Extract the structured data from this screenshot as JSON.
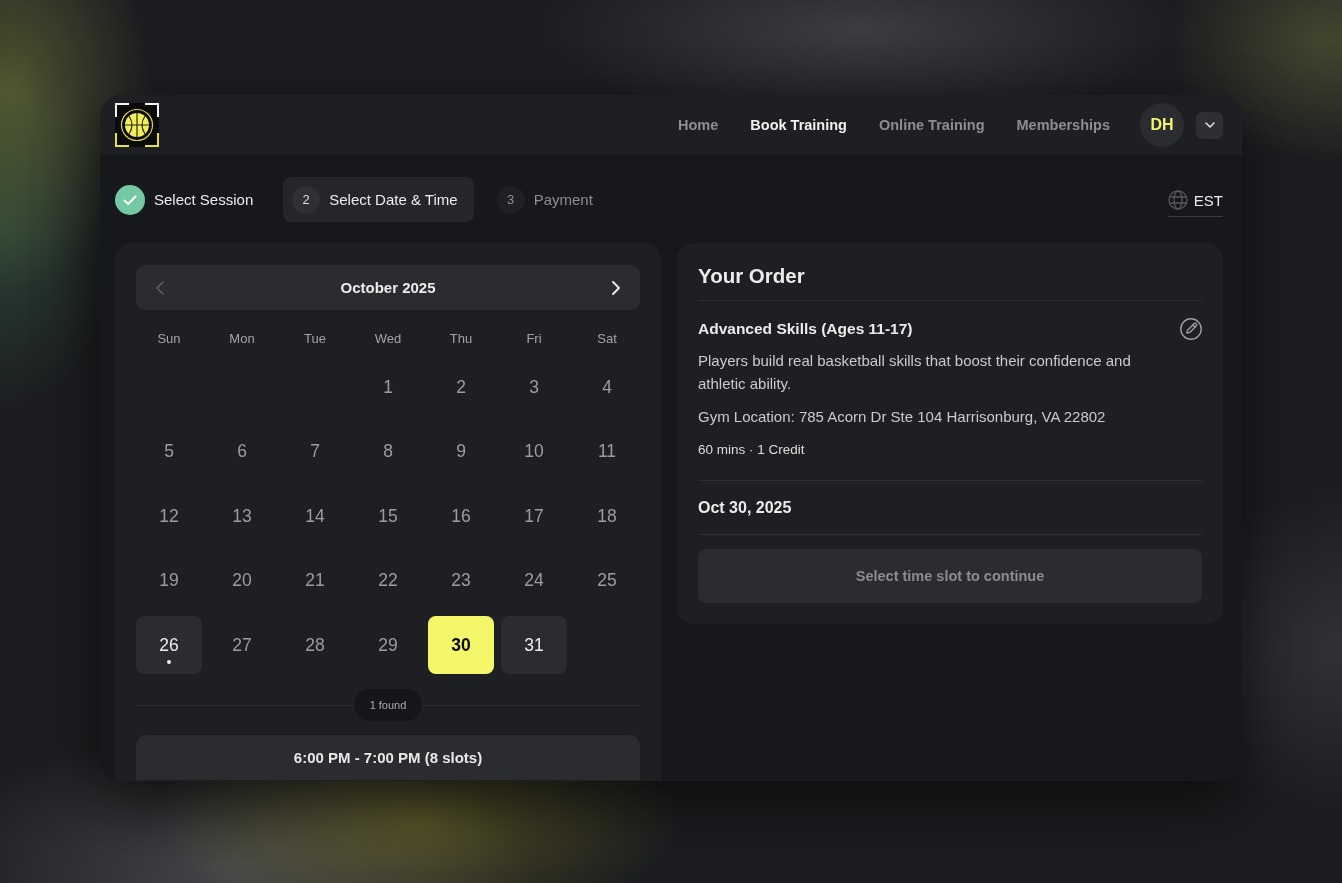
{
  "header": {
    "nav": [
      {
        "label": "Home",
        "selected": false
      },
      {
        "label": "Book Training",
        "selected": true
      },
      {
        "label": "Online Training",
        "selected": false
      },
      {
        "label": "Memberships",
        "selected": false
      }
    ],
    "avatar": {
      "initials": "DH"
    }
  },
  "stepper": {
    "steps": [
      {
        "label": "Select Session",
        "completed": true,
        "selected": false
      },
      {
        "number": "2",
        "label": "Select Date & Time",
        "completed": false,
        "selected": true
      },
      {
        "number": "3",
        "label": "Payment",
        "completed": false,
        "selected": false
      }
    ]
  },
  "timezone": {
    "label": "EST"
  },
  "calendar": {
    "month": "October 2025",
    "prev_button": {
      "disabled": true
    },
    "next_button": {
      "disabled": false
    },
    "weekdays": [
      "Sun",
      "Mon",
      "Tue",
      "Wed",
      "Thu",
      "Fri",
      "Sat"
    ],
    "weeks": [
      [
        {
          "kind": "blank"
        },
        {
          "kind": "blank"
        },
        {
          "kind": "blank"
        },
        {
          "kind": "day",
          "day": "1",
          "available": false,
          "selected": false,
          "marked": false
        },
        {
          "kind": "day",
          "day": "2",
          "available": false,
          "selected": false,
          "marked": false
        },
        {
          "kind": "day",
          "day": "3",
          "available": false,
          "selected": false,
          "marked": false
        },
        {
          "kind": "day",
          "day": "4",
          "available": false,
          "selected": false,
          "marked": false
        }
      ],
      [
        {
          "kind": "day",
          "day": "5",
          "available": false,
          "selected": false,
          "marked": false
        },
        {
          "kind": "day",
          "day": "6",
          "available": false,
          "selected": false,
          "marked": false
        },
        {
          "kind": "day",
          "day": "7",
          "available": false,
          "selected": false,
          "marked": false
        },
        {
          "kind": "day",
          "day": "8",
          "available": false,
          "selected": false,
          "marked": false
        },
        {
          "kind": "day",
          "day": "9",
          "available": false,
          "selected": false,
          "marked": false
        },
        {
          "kind": "day",
          "day": "10",
          "available": false,
          "selected": false,
          "marked": false
        },
        {
          "kind": "day",
          "day": "11",
          "available": false,
          "selected": false,
          "marked": false
        }
      ],
      [
        {
          "kind": "day",
          "day": "12",
          "available": false,
          "selected": false,
          "marked": false
        },
        {
          "kind": "day",
          "day": "13",
          "available": false,
          "selected": false,
          "marked": false
        },
        {
          "kind": "day",
          "day": "14",
          "available": false,
          "selected": false,
          "marked": false
        },
        {
          "kind": "day",
          "day": "15",
          "available": false,
          "selected": false,
          "marked": false
        },
        {
          "kind": "day",
          "day": "16",
          "available": false,
          "selected": false,
          "marked": false
        },
        {
          "kind": "day",
          "day": "17",
          "available": false,
          "selected": false,
          "marked": false
        },
        {
          "kind": "day",
          "day": "18",
          "available": false,
          "selected": false,
          "marked": false
        }
      ],
      [
        {
          "kind": "day",
          "day": "19",
          "available": false,
          "selected": false,
          "marked": false
        },
        {
          "kind": "day",
          "day": "20",
          "available": false,
          "selected": false,
          "marked": false
        },
        {
          "kind": "day",
          "day": "21",
          "available": false,
          "selected": false,
          "marked": false
        },
        {
          "kind": "day",
          "day": "22",
          "available": false,
          "selected": false,
          "marked": false
        },
        {
          "kind": "day",
          "day": "23",
          "available": false,
          "selected": false,
          "marked": false
        },
        {
          "kind": "day",
          "day": "24",
          "available": false,
          "selected": false,
          "marked": false
        },
        {
          "kind": "day",
          "day": "25",
          "available": false,
          "selected": false,
          "marked": false
        }
      ],
      [
        {
          "kind": "day",
          "day": "26",
          "available": true,
          "selected": false,
          "marked": true
        },
        {
          "kind": "day",
          "day": "27",
          "available": false,
          "selected": false,
          "marked": false
        },
        {
          "kind": "day",
          "day": "28",
          "available": false,
          "selected": false,
          "marked": false
        },
        {
          "kind": "day",
          "day": "29",
          "available": false,
          "selected": false,
          "marked": false
        },
        {
          "kind": "day",
          "day": "30",
          "available": true,
          "selected": true,
          "marked": false
        },
        {
          "kind": "day",
          "day": "31",
          "available": true,
          "selected": false,
          "marked": false
        },
        {
          "kind": "blank"
        }
      ]
    ],
    "results": {
      "count": "1 found"
    },
    "slots": [
      {
        "label": "6:00 PM - 7:00 PM (8 slots)",
        "selected": false
      }
    ]
  },
  "order": {
    "title": "Your Order",
    "session": {
      "name": "Advanced Skills (Ages 11-17)",
      "description": "Players build real basketball skills that boost their confidence and athletic ability.",
      "location": "Gym Location: 785 Acorn Dr Ste 104 Harrisonburg, VA 22802",
      "meta": "60 mins · 1 Credit"
    },
    "date": "Oct 30, 2025",
    "continue_button": {
      "label": "Select time slot to continue",
      "disabled": true
    }
  }
}
